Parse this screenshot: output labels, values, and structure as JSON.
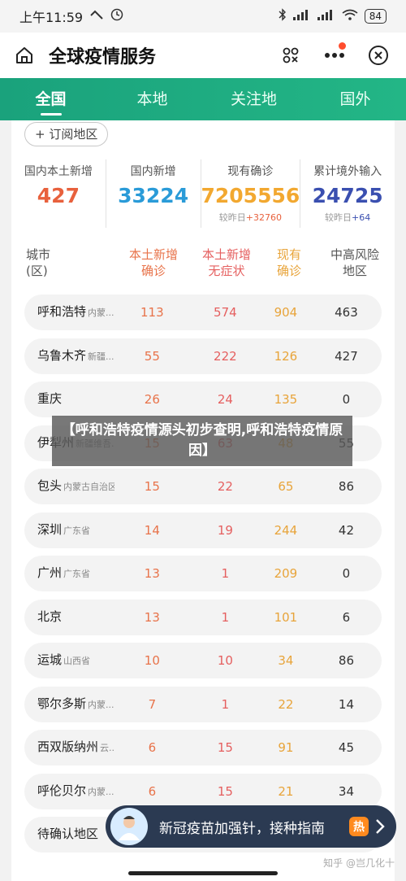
{
  "status_bar": {
    "time": "上午11:59",
    "network": "4G",
    "battery": "84"
  },
  "app": {
    "title": "全球疫情服务"
  },
  "tabs": [
    "全国",
    "本地",
    "关注地",
    "国外"
  ],
  "subscribe_button": "+ 订阅地区",
  "stats": [
    {
      "label": "国内本土新增",
      "value": "427",
      "color": "#e8613d",
      "delta_label": "",
      "delta": ""
    },
    {
      "label": "国内新增",
      "value": "33224",
      "color": "#2a9bd8",
      "delta_label": "",
      "delta": ""
    },
    {
      "label": "现有确诊",
      "value": "7205556",
      "color": "#f2a830",
      "delta_label": "较昨日",
      "delta": "+32760"
    },
    {
      "label": "累计境外输入",
      "value": "24725",
      "color": "#3a4fb0",
      "delta_label": "较昨日",
      "delta": "+64"
    }
  ],
  "table": {
    "headers": [
      {
        "line1": "城市",
        "line2": "(区)",
        "color": "#555"
      },
      {
        "line1": "本土新增",
        "line2": "确诊",
        "color": "#e8734a"
      },
      {
        "line1": "本土新增",
        "line2": "无症状",
        "color": "#e55f5f"
      },
      {
        "line1": "现有",
        "line2": "确诊",
        "color": "#e8a43a"
      },
      {
        "line1": "中高风险",
        "line2": "地区",
        "color": "#555"
      }
    ],
    "rows": [
      {
        "city": "呼和浩特",
        "region": "内蒙...",
        "confirmed": "113",
        "asymptomatic": "574",
        "current": "904",
        "risk": "463"
      },
      {
        "city": "乌鲁木齐",
        "region": "新疆...",
        "confirmed": "55",
        "asymptomatic": "222",
        "current": "126",
        "risk": "427"
      },
      {
        "city": "重庆",
        "region": "",
        "confirmed": "26",
        "asymptomatic": "24",
        "current": "135",
        "risk": "0"
      },
      {
        "city": "伊犁州",
        "region": "新疆维吾...",
        "confirmed": "15",
        "asymptomatic": "63",
        "current": "48",
        "risk": "55"
      },
      {
        "city": "包头",
        "region": "内蒙古自治区",
        "confirmed": "15",
        "asymptomatic": "22",
        "current": "65",
        "risk": "86"
      },
      {
        "city": "深圳",
        "region": "广东省",
        "confirmed": "14",
        "asymptomatic": "19",
        "current": "244",
        "risk": "42"
      },
      {
        "city": "广州",
        "region": "广东省",
        "confirmed": "13",
        "asymptomatic": "1",
        "current": "209",
        "risk": "0"
      },
      {
        "city": "北京",
        "region": "",
        "confirmed": "13",
        "asymptomatic": "1",
        "current": "101",
        "risk": "6"
      },
      {
        "city": "运城",
        "region": "山西省",
        "confirmed": "10",
        "asymptomatic": "10",
        "current": "34",
        "risk": "86"
      },
      {
        "city": "鄂尔多斯",
        "region": "内蒙...",
        "confirmed": "7",
        "asymptomatic": "1",
        "current": "22",
        "risk": "14"
      },
      {
        "city": "西双版纳州",
        "region": "云...",
        "confirmed": "6",
        "asymptomatic": "15",
        "current": "91",
        "risk": "45"
      },
      {
        "city": "呼伦贝尔",
        "region": "内蒙...",
        "confirmed": "6",
        "asymptomatic": "15",
        "current": "21",
        "risk": "34"
      },
      {
        "city": "待确认地区",
        "region": "",
        "confirmed": "",
        "asymptomatic": "",
        "current": "",
        "risk": ""
      }
    ]
  },
  "overlay_caption": "【呼和浩特疫情源头初步查明,呼和浩特疫情原因】",
  "banner": {
    "text": "新冠疫苗加强针，接种指南",
    "badge": "热"
  },
  "watermark": "知乎 @岂几化十"
}
